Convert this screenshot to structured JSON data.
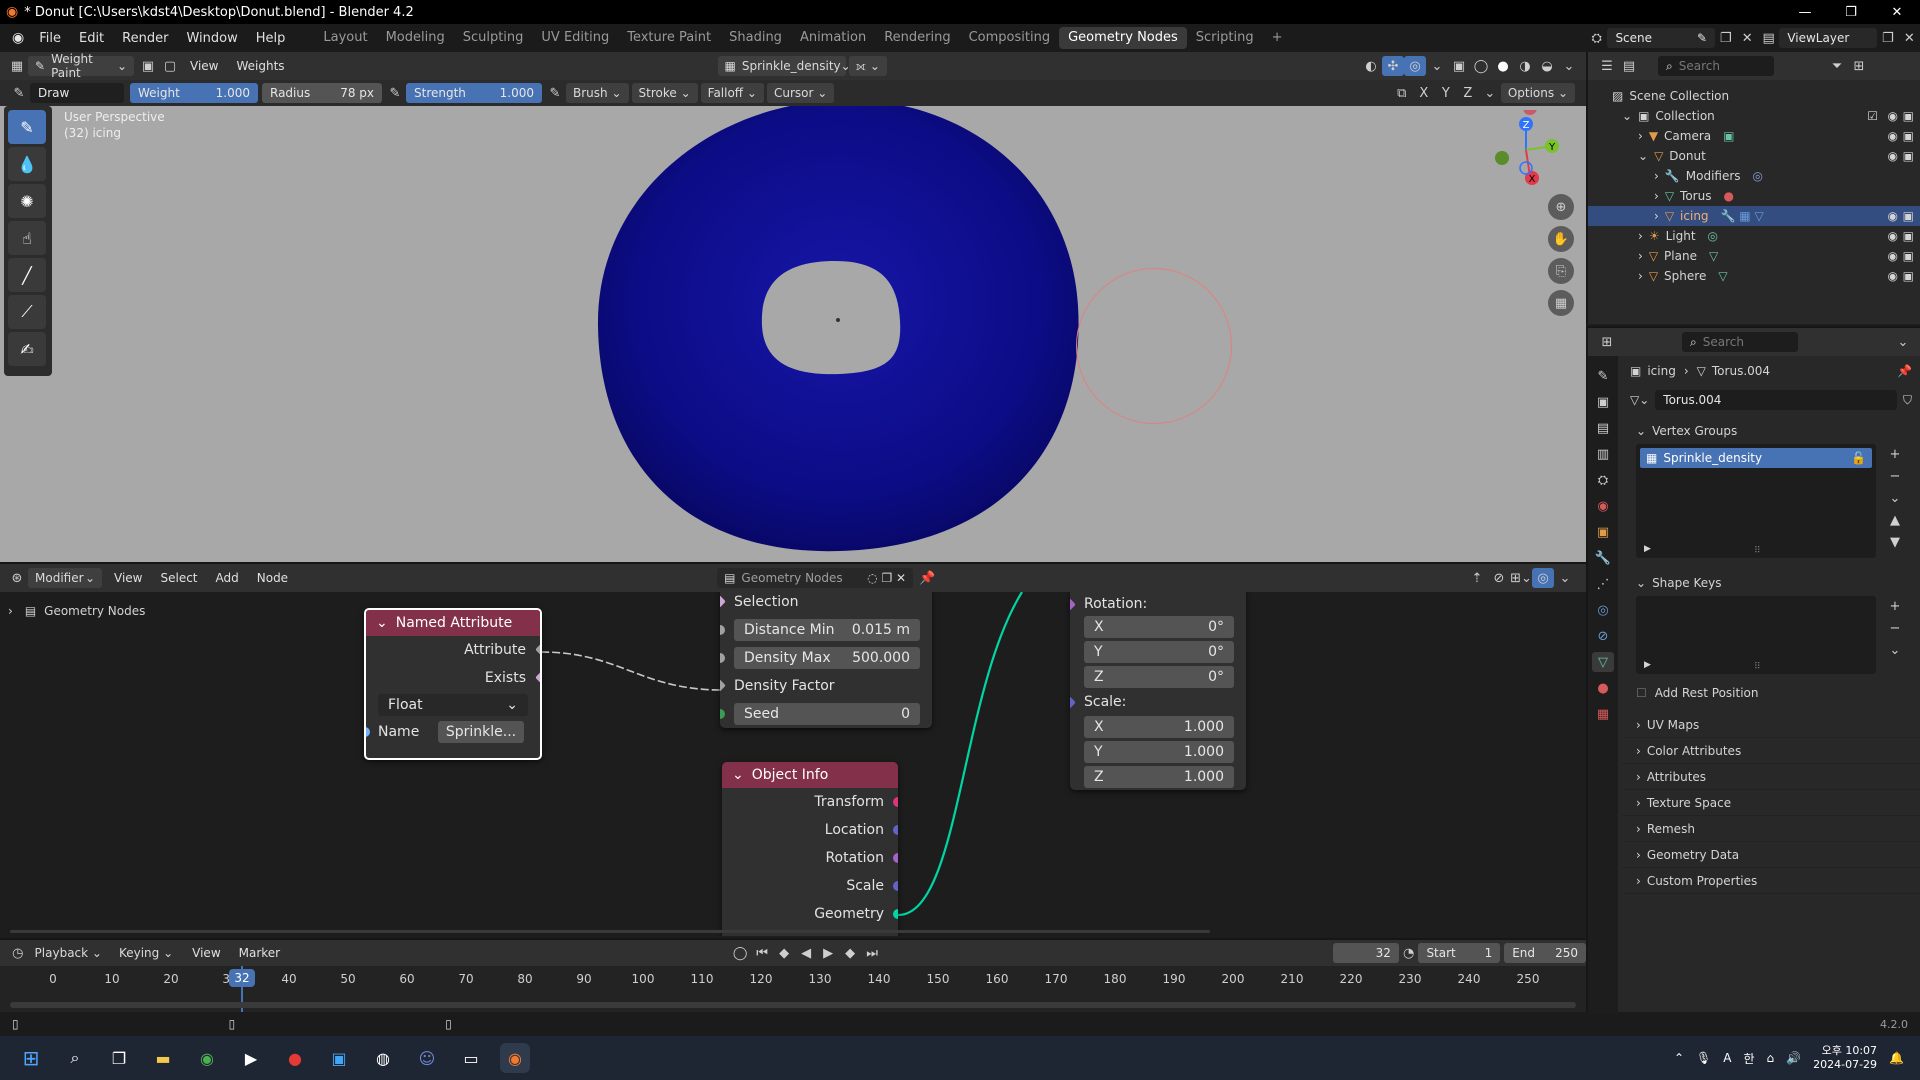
{
  "window": {
    "title": "* Donut [C:\\Users\\kdst4\\Desktop\\Donut.blend] - Blender 4.2"
  },
  "menus": [
    "File",
    "Edit",
    "Render",
    "Window",
    "Help"
  ],
  "workspaces": [
    "Layout",
    "Modeling",
    "Sculpting",
    "UV Editing",
    "Texture Paint",
    "Shading",
    "Animation",
    "Rendering",
    "Compositing",
    "Geometry Nodes",
    "Scripting"
  ],
  "active_workspace": "Geometry Nodes",
  "topright": {
    "scene": "Scene",
    "view_layer": "ViewLayer"
  },
  "viewport_header": {
    "mode": "Weight Paint",
    "menu_view": "View",
    "menu_weights": "Weights",
    "vertex_group": "Sprinkle_density",
    "options": "Options"
  },
  "tool_settings": {
    "tool": "Draw",
    "weight_label": "Weight",
    "weight_value": "1.000",
    "radius_label": "Radius",
    "radius_value": "78 px",
    "strength_label": "Strength",
    "strength_value": "1.000",
    "brush": "Brush",
    "stroke": "Stroke",
    "falloff": "Falloff",
    "cursor": "Cursor",
    "axis_x": "X",
    "axis_y": "Y",
    "axis_z": "Z"
  },
  "viewport": {
    "perspective": "User Perspective",
    "object_info": "(32) icing",
    "donut_color": "#0d0d88",
    "background": "#a8a8a8",
    "gizmo": {
      "x": "X",
      "y": "Y",
      "z": "Z"
    }
  },
  "node_editor": {
    "header": {
      "editor": "Modifier",
      "view": "View",
      "select": "Select",
      "add": "Add",
      "node": "Node",
      "tree": "Geometry Nodes"
    },
    "breadcrumb": "Geometry Nodes",
    "named_attribute": {
      "title": "Named Attribute",
      "attribute": "Attribute",
      "exists": "Exists",
      "type": "Float",
      "name_label": "Name",
      "name_value": "Sprinkle..."
    },
    "distribute": {
      "selection": "Selection",
      "distance_min_label": "Distance Min",
      "distance_min_value": "0.015 m",
      "density_max_label": "Density Max",
      "density_max_value": "500.000",
      "density_factor": "Density Factor",
      "seed_label": "Seed",
      "seed_value": "0"
    },
    "object_info": {
      "title": "Object Info",
      "outputs": [
        "Transform",
        "Location",
        "Rotation",
        "Scale",
        "Geometry"
      ]
    },
    "transform": {
      "rotation_label": "Rotation:",
      "rotation": [
        {
          "axis": "X",
          "value": "0°"
        },
        {
          "axis": "Y",
          "value": "0°"
        },
        {
          "axis": "Z",
          "value": "0°"
        }
      ],
      "scale_label": "Scale:",
      "scale": [
        {
          "axis": "X",
          "value": "1.000"
        },
        {
          "axis": "Y",
          "value": "1.000"
        },
        {
          "axis": "Z",
          "value": "1.000"
        }
      ]
    }
  },
  "timeline": {
    "playback": "Playback",
    "keying": "Keying",
    "view": "View",
    "marker": "Marker",
    "current_frame": "32",
    "start_label": "Start",
    "start": "1",
    "end_label": "End",
    "end": "250",
    "ticks": [
      "0",
      "10",
      "20",
      "30",
      "40",
      "50",
      "60",
      "70",
      "80",
      "90",
      "100",
      "110",
      "120",
      "130",
      "140",
      "150",
      "160",
      "170",
      "180",
      "190",
      "200",
      "210",
      "220",
      "230",
      "240",
      "250"
    ],
    "marker_frame": "32"
  },
  "outliner": {
    "search_placeholder": "Search",
    "root": "Scene Collection",
    "items": [
      {
        "label": "Collection",
        "level": 0
      },
      {
        "label": "Camera",
        "level": 1
      },
      {
        "label": "Donut",
        "level": 1
      },
      {
        "label": "Modifiers",
        "level": 2
      },
      {
        "label": "Torus",
        "level": 2
      },
      {
        "label": "icing",
        "level": 2,
        "selected": true
      },
      {
        "label": "Light",
        "level": 1
      },
      {
        "label": "Plane",
        "level": 1
      },
      {
        "label": "Sphere",
        "level": 1
      }
    ]
  },
  "properties": {
    "search_placeholder": "Search",
    "breadcrumb_object": "icing",
    "breadcrumb_data": "Torus.004",
    "mesh_name": "Torus.004",
    "vertex_groups_label": "Vertex Groups",
    "vertex_group_item": "Sprinkle_density",
    "shape_keys_label": "Shape Keys",
    "add_rest_position": "Add Rest Position",
    "sections": [
      "UV Maps",
      "Color Attributes",
      "Attributes",
      "Texture Space",
      "Remesh",
      "Geometry Data",
      "Custom Properties"
    ]
  },
  "status": {
    "version": "4.2.0"
  },
  "taskbar": {
    "time": "10:07",
    "date": "2024-07-29",
    "period": "오후",
    "lang": "A",
    "ime": "한"
  }
}
